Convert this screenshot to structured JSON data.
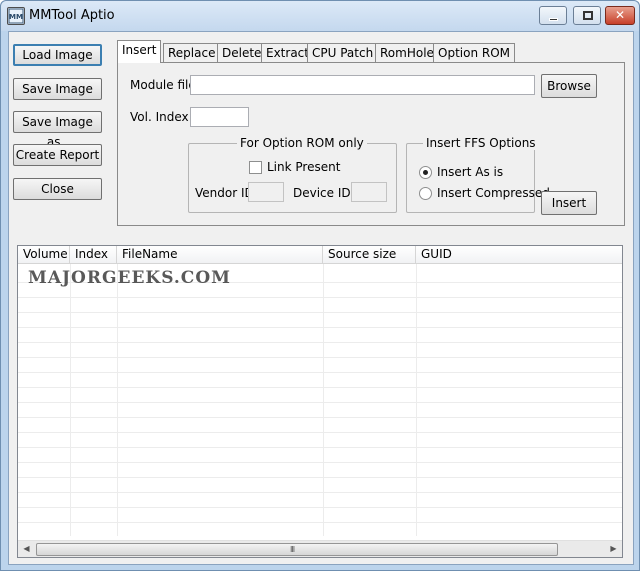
{
  "window": {
    "title": "MMTool Aptio",
    "icon": "mmtool-app-icon",
    "minimize_icon": "minimize-icon",
    "maximize_icon": "maximize-icon",
    "close_glyph": "✕"
  },
  "side_buttons": {
    "load_image": "Load Image",
    "save_image": "Save Image",
    "save_image_as": "Save Image as..",
    "create_report": "Create Report",
    "close": "Close"
  },
  "tabs": [
    {
      "label": "Insert",
      "active": true
    },
    {
      "label": "Replace",
      "active": false
    },
    {
      "label": "Delete",
      "active": false
    },
    {
      "label": "Extract",
      "active": false
    },
    {
      "label": "CPU Patch",
      "active": false
    },
    {
      "label": "RomHole",
      "active": false
    },
    {
      "label": "Option ROM",
      "active": false
    }
  ],
  "insert_panel": {
    "module_file_label": "Module file",
    "module_file_value": "",
    "browse_label": "Browse",
    "vol_index_label": "Vol. Index",
    "vol_index_value": "",
    "option_rom_group": {
      "title": "For Option ROM only",
      "link_present_label": "Link Present",
      "link_present_checked": false,
      "vendor_id_label": "Vendor ID",
      "device_id_label": "Device ID"
    },
    "ffs_group": {
      "title": "Insert FFS Options",
      "insert_as_is_label": "Insert As is",
      "insert_as_is_selected": true,
      "insert_compressed_label": "Insert Compressed",
      "insert_compressed_selected": false
    },
    "insert_label": "Insert"
  },
  "list": {
    "columns": [
      "Volume",
      "Index",
      "FileName",
      "Source size",
      "GUID"
    ],
    "rows": [],
    "watermark": "MAJORGEEKS.COM",
    "scroll_grip": "III"
  }
}
